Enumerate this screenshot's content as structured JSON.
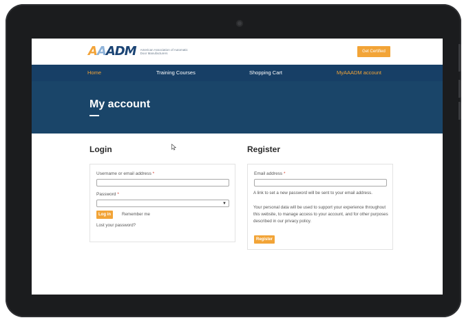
{
  "header": {
    "logo_mark": {
      "a1": "A",
      "a2": "A",
      "rest": "ADM"
    },
    "logo_text": "American Association of Automatic Door Manufacturers",
    "cta_label": "Get Certified"
  },
  "nav": {
    "items": [
      {
        "label": "Home",
        "active": true
      },
      {
        "label": "Training Courses",
        "active": false
      },
      {
        "label": "Shopping Cart",
        "active": false
      },
      {
        "label": "MyAAADM account",
        "active": true
      }
    ]
  },
  "hero": {
    "title": "My account"
  },
  "login": {
    "title": "Login",
    "username_label": "Username or email address",
    "password_label": "Password",
    "required_mark": "*",
    "submit_label": "Log in",
    "remember_label": "Remember me",
    "lost_password": "Lost your password?"
  },
  "register": {
    "title": "Register",
    "email_label": "Email address",
    "required_mark": "*",
    "password_note": "A link to set a new password will be sent to your email address.",
    "privacy_text": "Your personal data will be used to support your experience throughout this website, to manage access to your account, and for other purposes described in our privacy policy.",
    "submit_label": "Register"
  },
  "colors": {
    "accent": "#f2a437",
    "nav_bg": "#173f66",
    "hero_bg": "#1a4569",
    "bezel": "#1b1c1e"
  },
  "icons": {
    "cursor": "mouse-pointer-icon",
    "caret": "chevron-down-icon",
    "camera": "camera-icon"
  }
}
